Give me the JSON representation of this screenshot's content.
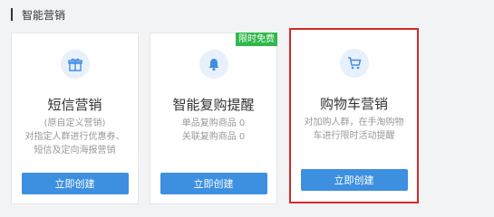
{
  "section": {
    "title": "智能营销"
  },
  "cards": [
    {
      "icon": "gift-icon",
      "title": "短信营销",
      "desc_lines": [
        "(原自定义营销)",
        "对指定人群进行优惠券、",
        "短信及定向海报营销"
      ],
      "button_label": "立即创建"
    },
    {
      "icon": "bell-icon",
      "title": "智能复购提醒",
      "badge": "限时免费",
      "desc_lines": [
        "单品复购商品 0",
        "关联复购商品 0"
      ],
      "button_label": "立即创建"
    },
    {
      "icon": "shopping-cart-icon",
      "title": "购物车营销",
      "desc_lines": [
        "对加购人群，在手淘购物",
        "车进行限时活动提醒"
      ],
      "button_label": "立即创建"
    }
  ],
  "colors": {
    "accent": "#3d8fe0",
    "badge": "#2fb84b",
    "highlight_border": "#d42a2a"
  }
}
